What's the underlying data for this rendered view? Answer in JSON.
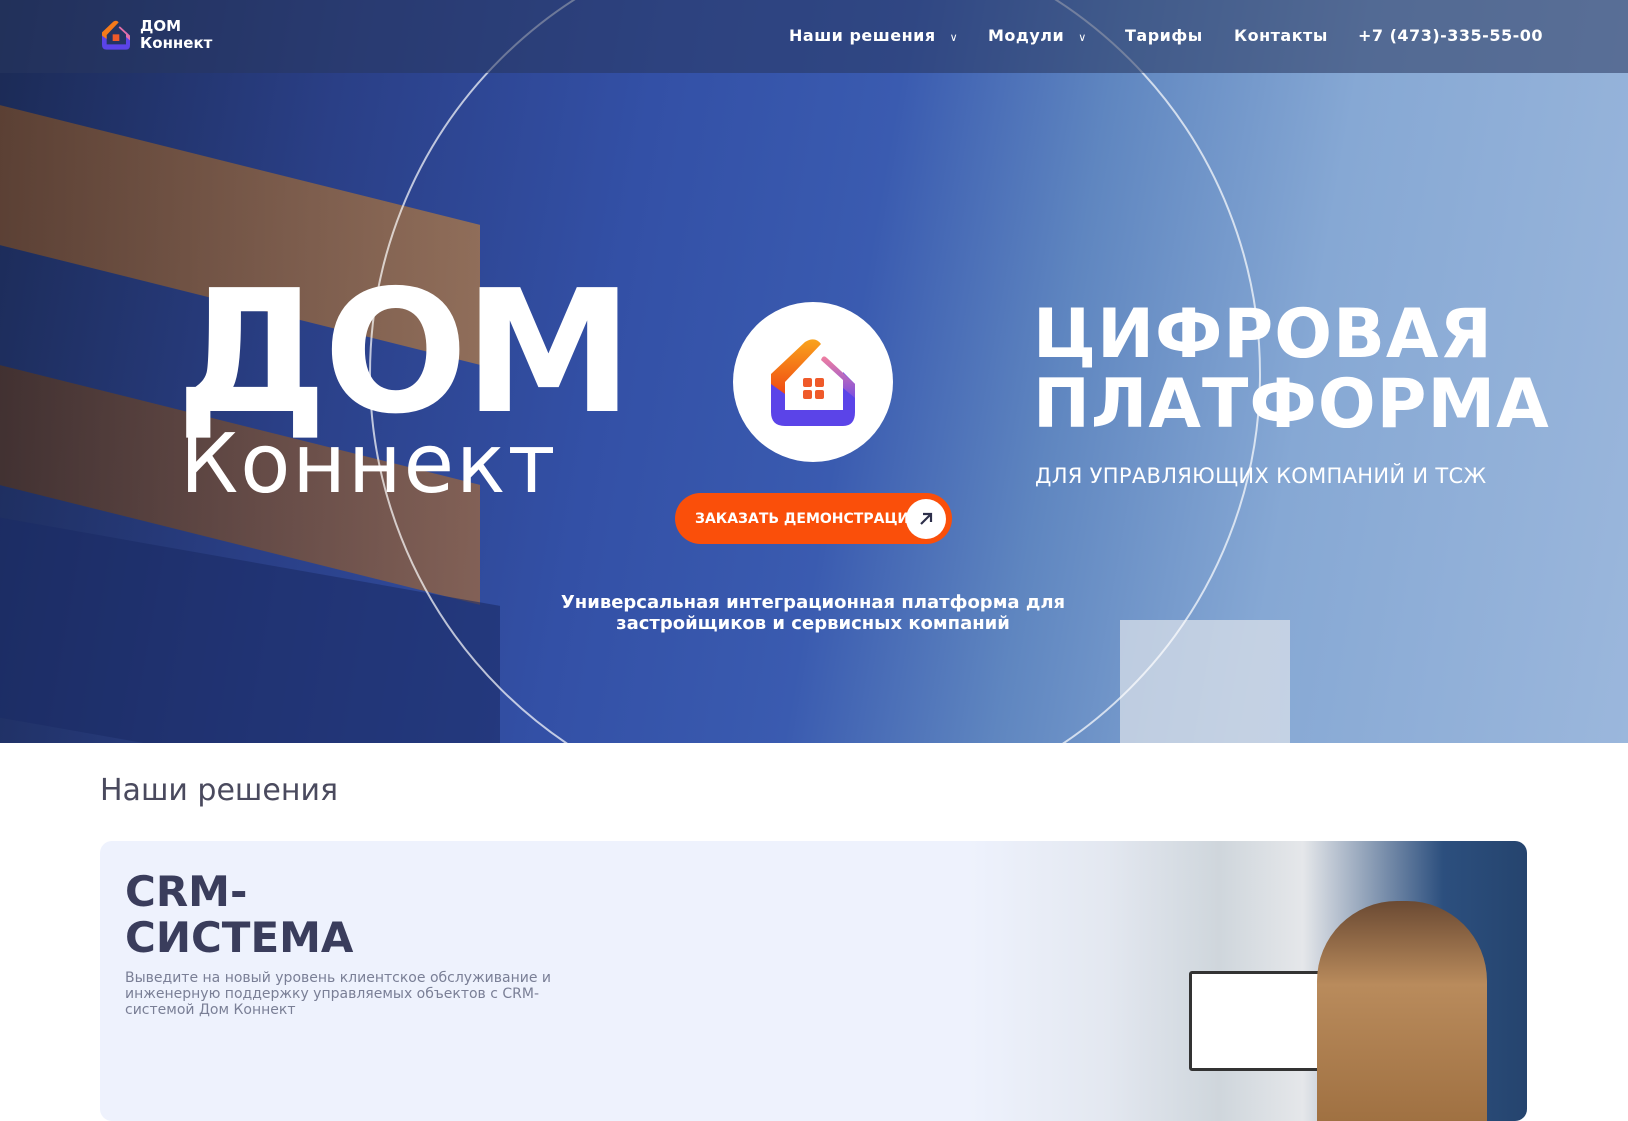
{
  "header": {
    "logo_text_1": "ДОМ",
    "logo_text_2": "Коннект",
    "nav": [
      {
        "label": "Наши решения",
        "dropdown": true
      },
      {
        "label": "Модули",
        "dropdown": true
      },
      {
        "label": "Тарифы"
      },
      {
        "label": "Контакты"
      },
      {
        "label": "+7 (473)-335-55-00"
      }
    ]
  },
  "hero": {
    "title_1": "ДОМ",
    "title_2": "Коннект",
    "cta": "ЗАКАЗАТЬ ДЕМОНСТРАЦИЮ",
    "subtitle": "Универсальная интеграционная платформа для застройщиков и сервисных компаний",
    "right_title_1": "ЦИФРОВАЯ",
    "right_title_2": "ПЛАТФОРМА",
    "right_subtitle": "ДЛЯ УПРАВЛЯЮЩИХ КОМПАНИЙ И ТСЖ"
  },
  "solutions": {
    "title": "Наши решения",
    "card": {
      "title_1": "CRM-",
      "title_2": "СИСТЕМА",
      "description": "Выведите на новый уровень клиентское обслуживание и инженерную поддержку управляемых объектов с CRM-системой Дом Коннект"
    }
  },
  "colors": {
    "accent": "#fa4f0a",
    "brand_purple": "#5b44e8",
    "heading": "#3a3d5c"
  }
}
